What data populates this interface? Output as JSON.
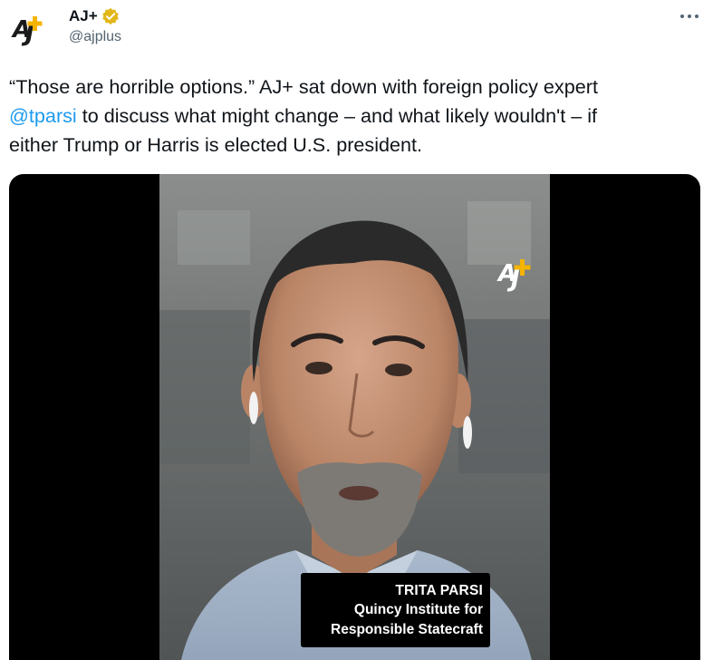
{
  "author": {
    "display_name": "AJ+",
    "handle": "@ajplus",
    "verified": true,
    "avatar_icon": "ajplus-logo-icon",
    "verified_icon": "verified-badge-icon"
  },
  "menu": {
    "more_icon": "more-options-icon",
    "more_label": "•••"
  },
  "tweet": {
    "text_line1": "“Those are horrible options.” AJ+ sat down with foreign policy expert",
    "mention": "@tparsi",
    "text_line2_rest": " to discuss what might change – and what likely wouldn't – if",
    "text_line3": "either Trump or Harris is elected U.S. president."
  },
  "media": {
    "type": "video",
    "watermark_icon": "ajplus-watermark-icon",
    "lower_third": {
      "name": "TRITA PARSI",
      "org_line1": "Quincy Institute for",
      "org_line2": "Responsible Statecraft"
    }
  },
  "colors": {
    "text": "#0f1419",
    "secondary_text": "#536471",
    "link": "#1d9bf0",
    "brand_yellow": "#f6b400",
    "verified_gold": "#e2b719",
    "media_background": "#000000"
  }
}
